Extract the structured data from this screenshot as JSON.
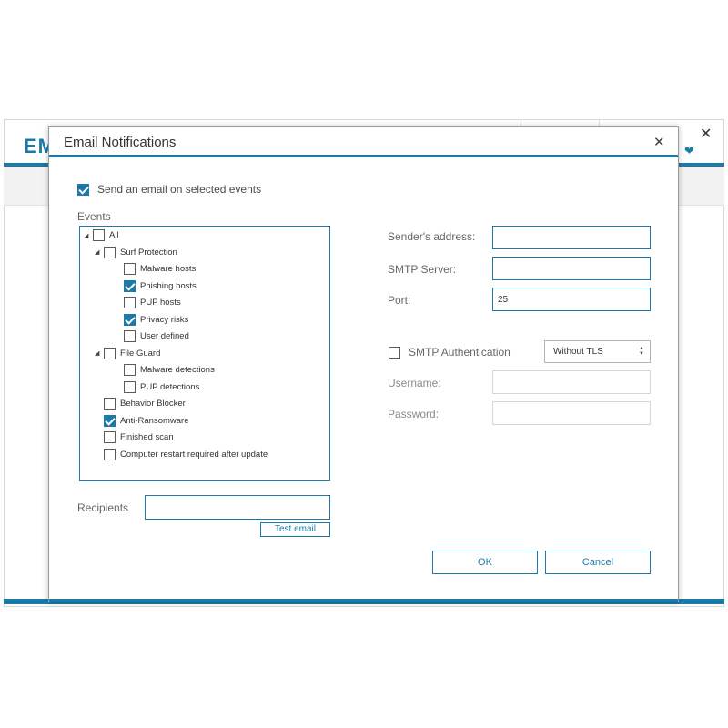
{
  "background": {
    "logo_text": "EM",
    "close_glyph": "✕",
    "heart_icon": "heart-icon"
  },
  "dialog": {
    "title": "Email Notifications",
    "close_glyph": "✕",
    "send_email_label": "Send an email on selected events",
    "send_email_checked": true,
    "events_label": "Events",
    "events": [
      {
        "label": "All",
        "level": 0,
        "expandable": true,
        "checked": false
      },
      {
        "label": "Surf Protection",
        "level": 1,
        "expandable": true,
        "checked": false
      },
      {
        "label": "Malware hosts",
        "level": 2,
        "expandable": false,
        "checked": false
      },
      {
        "label": "Phishing hosts",
        "level": 2,
        "expandable": false,
        "checked": true
      },
      {
        "label": "PUP hosts",
        "level": 2,
        "expandable": false,
        "checked": false
      },
      {
        "label": "Privacy risks",
        "level": 2,
        "expandable": false,
        "checked": true
      },
      {
        "label": "User defined",
        "level": 2,
        "expandable": false,
        "checked": false
      },
      {
        "label": "File Guard",
        "level": 1,
        "expandable": true,
        "checked": false
      },
      {
        "label": "Malware detections",
        "level": 2,
        "expandable": false,
        "checked": false
      },
      {
        "label": "PUP detections",
        "level": 2,
        "expandable": false,
        "checked": false
      },
      {
        "label": "Behavior Blocker",
        "level": 1,
        "expandable": false,
        "checked": false
      },
      {
        "label": "Anti-Ransomware",
        "level": 1,
        "expandable": false,
        "checked": true
      },
      {
        "label": "Finished scan",
        "level": 1,
        "expandable": false,
        "checked": false
      },
      {
        "label": "Computer restart required after update",
        "level": 1,
        "expandable": false,
        "checked": false
      }
    ],
    "recipients_label": "Recipients",
    "recipients_value": "",
    "test_email_label": "Test email",
    "senders_address_label": "Sender's address:",
    "senders_address_value": "",
    "smtp_server_label": "SMTP Server:",
    "smtp_server_value": "",
    "port_label": "Port:",
    "port_value": "25",
    "smtp_auth_label": "SMTP Authentication",
    "smtp_auth_checked": false,
    "tls_selected": "Without TLS",
    "username_label": "Username:",
    "username_value": "",
    "password_label": "Password:",
    "password_value": "",
    "ok_label": "OK",
    "cancel_label": "Cancel"
  },
  "colors": {
    "accent": "#1b7aa8",
    "border_disabled": "#d5d5d5"
  }
}
